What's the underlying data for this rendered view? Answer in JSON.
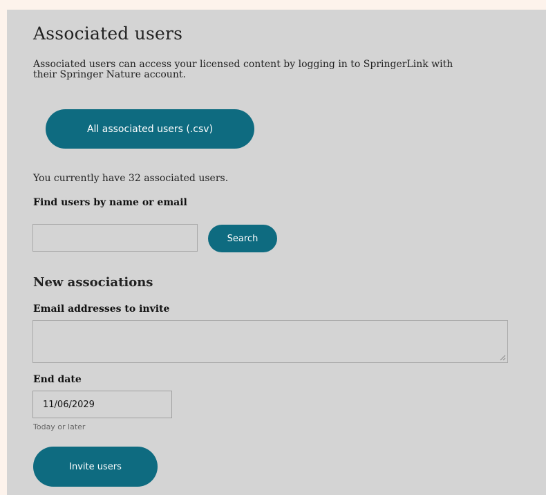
{
  "page": {
    "title": "Associated users",
    "description": "Associated users can access your licensed content by logging in to SpringerLink with their Springer Nature account."
  },
  "export": {
    "button_label": "All associated users (.csv)"
  },
  "summary": {
    "count_text": "You currently have 32 associated users."
  },
  "find": {
    "label": "Find users by name or email",
    "input_value": "",
    "search_label": "Search"
  },
  "new_associations": {
    "heading": "New associations",
    "email_label": "Email addresses to invite",
    "email_value": "",
    "end_date_label": "End date",
    "end_date_value": "11/06/2029",
    "end_date_hint": "Today or later",
    "invite_label": "Invite users"
  },
  "colors": {
    "page_background": "#fdf3ec",
    "panel_background": "#d4d4d4",
    "button_accent": "#0e6b80",
    "button_text": "#ffffff"
  }
}
